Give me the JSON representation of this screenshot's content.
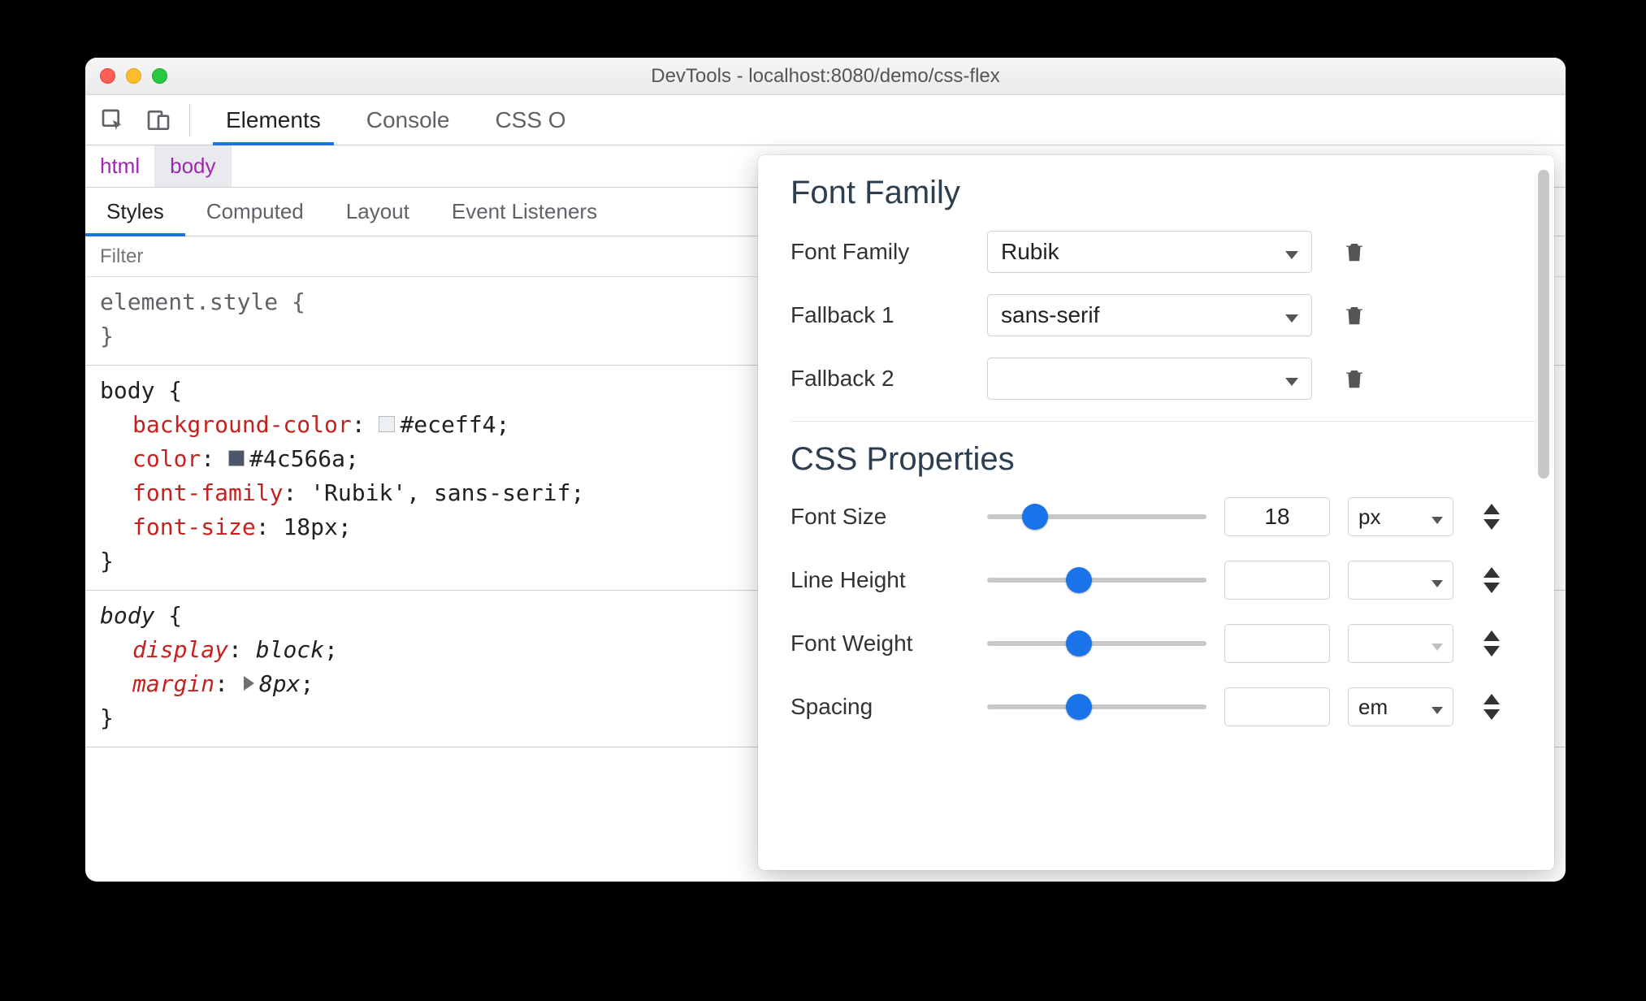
{
  "window": {
    "title": "DevTools - localhost:8080/demo/css-flex"
  },
  "mainTabs": [
    "Elements",
    "Console",
    "CSS O"
  ],
  "mainActiveIndex": 0,
  "breadcrumbs": [
    "html",
    "body"
  ],
  "breadcrumbActiveIndex": 1,
  "subtabs": [
    "Styles",
    "Computed",
    "Layout",
    "Event Listeners"
  ],
  "subtabActiveIndex": 0,
  "filterPlaceholder": "Filter",
  "css": {
    "elementStyle": "element.style {",
    "closeBrace": "}",
    "rule1": {
      "selector": "body",
      "decls": [
        {
          "prop": "background-color",
          "value": "#eceff4",
          "swatch": "#eceff4"
        },
        {
          "prop": "color",
          "value": "#4c566a",
          "swatch": "#4c566a"
        },
        {
          "prop": "font-family",
          "value": "'Rubik', sans-serif"
        },
        {
          "prop": "font-size",
          "value": "18px"
        }
      ]
    },
    "rule2": {
      "selector": "body",
      "ua": true,
      "decls": [
        {
          "prop": "display",
          "value": "block"
        },
        {
          "prop": "margin",
          "value": "8px",
          "expandable": true
        }
      ]
    }
  },
  "panel": {
    "fontFamilyHeading": "Font Family",
    "fontFamilyLabel": "Font Family",
    "fontFamilyValue": "Rubik",
    "fallback1Label": "Fallback 1",
    "fallback1Value": "sans-serif",
    "fallback2Label": "Fallback 2",
    "fallback2Value": "",
    "cssPropsHeading": "CSS Properties",
    "rows": [
      {
        "label": "Font Size",
        "thumb": 22,
        "value": "18",
        "unit": "px",
        "unitDisabled": false
      },
      {
        "label": "Line Height",
        "thumb": 42,
        "value": "",
        "unit": "",
        "unitDisabled": false
      },
      {
        "label": "Font Weight",
        "thumb": 42,
        "value": "",
        "unit": "",
        "unitDisabled": true
      },
      {
        "label": "Spacing",
        "thumb": 42,
        "value": "",
        "unit": "em",
        "unitDisabled": false
      }
    ]
  }
}
